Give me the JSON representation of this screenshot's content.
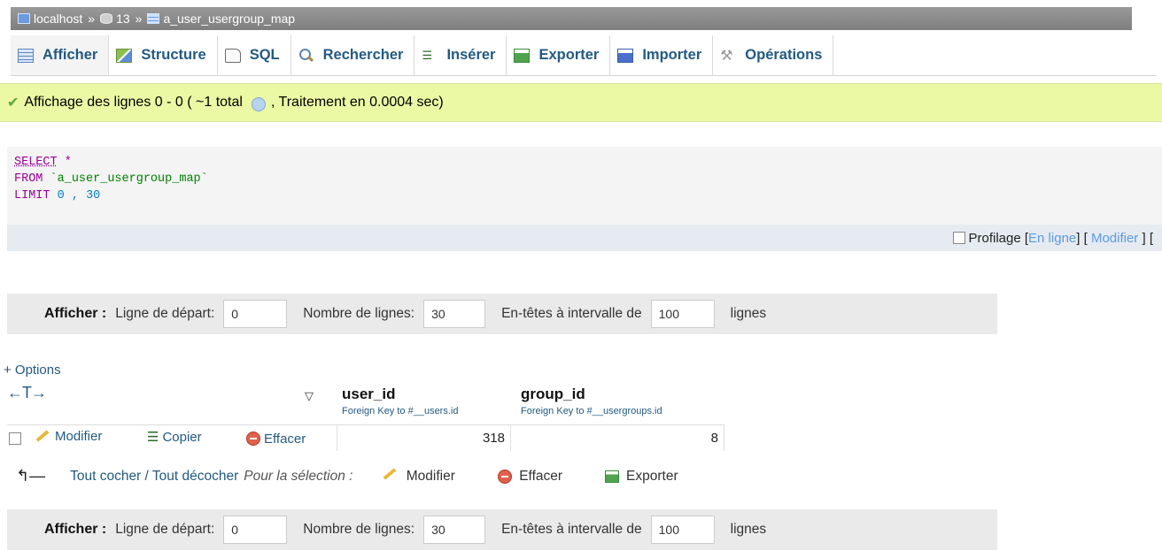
{
  "breadcrumb": {
    "server": "localhost",
    "database": "13",
    "table": "a_user_usergroup_map",
    "separator": "»"
  },
  "tabs": [
    {
      "label": "Afficher",
      "icon": "browse-icon",
      "active": true
    },
    {
      "label": "Structure",
      "icon": "structure-icon"
    },
    {
      "label": "SQL",
      "icon": "sql-icon"
    },
    {
      "label": "Rechercher",
      "icon": "search-icon"
    },
    {
      "label": "Insérer",
      "icon": "insert-icon"
    },
    {
      "label": "Exporter",
      "icon": "export-icon"
    },
    {
      "label": "Importer",
      "icon": "import-icon"
    },
    {
      "label": "Opérations",
      "icon": "operations-icon"
    }
  ],
  "status": {
    "text_before": "Affichage des lignes 0 - 0 ( ~1 total",
    "text_after": ", Traitement en 0.0004 sec)",
    "color": "#ebf8a4"
  },
  "sql": {
    "select": "SELECT",
    "star": "*",
    "from": "FROM",
    "table": "`a_user_usergroup_map`",
    "limit": "LIMIT",
    "offset": "0",
    "comma": ",",
    "count": "30"
  },
  "profiling": {
    "label": "Profilage",
    "inline_link": "En ligne",
    "edit_link": "Modifier",
    "open": "[",
    "close": "]",
    "trailing": "["
  },
  "nav": {
    "show_label": "Afficher :",
    "start_label": "Ligne de départ:",
    "start_value": "0",
    "rows_label": "Nombre de lignes:",
    "rows_value": "30",
    "headers_label": "En-têtes à intervalle de",
    "headers_value": "100",
    "lines_label": "lignes"
  },
  "results": {
    "options_label": "+ Options",
    "arrows": "←T→",
    "columns": [
      {
        "name": "user_id",
        "hint": "Foreign Key to #__users.id"
      },
      {
        "name": "group_id",
        "hint": "Foreign Key to #__usergroups.id"
      }
    ],
    "rows": [
      {
        "user_id": "318",
        "group_id": "8"
      }
    ],
    "row_actions": {
      "edit": "Modifier",
      "copy": "Copier",
      "delete": "Effacer"
    }
  },
  "bulk": {
    "check_all": "Tout cocher / Tout décocher",
    "with_selected": "Pour la sélection :",
    "edit": "Modifier",
    "delete": "Effacer",
    "export": "Exporter"
  }
}
